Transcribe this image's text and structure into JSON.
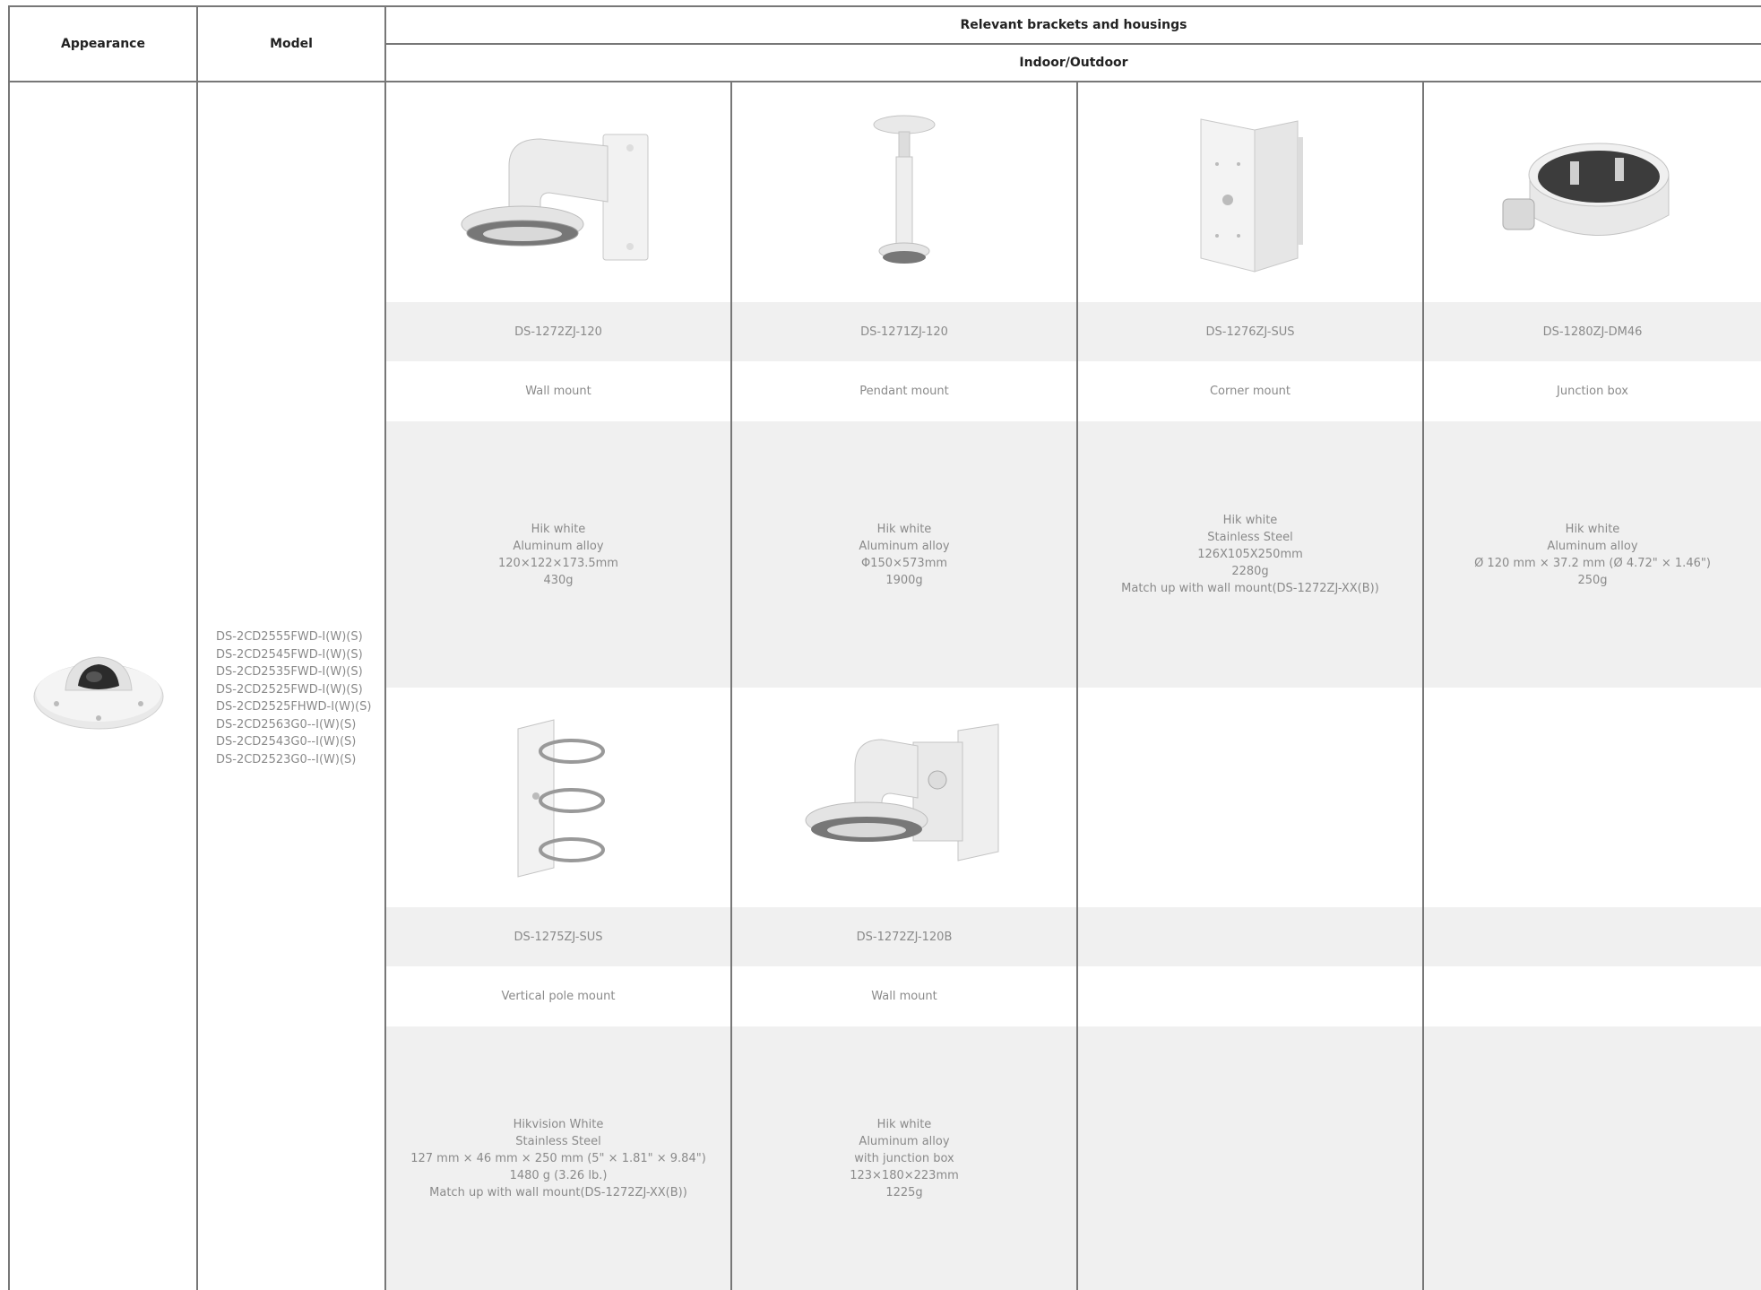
{
  "header": {
    "appearance": "Appearance",
    "model": "Model",
    "relevant": "Relevant brackets and housings",
    "indoor_outdoor": "Indoor/Outdoor"
  },
  "camera": {
    "image_icon": "mini-dome-camera-icon",
    "models": [
      "DS-2CD2555FWD-I(W)(S)",
      "DS-2CD2545FWD-I(W)(S)",
      "DS-2CD2535FWD-I(W)(S)",
      "DS-2CD2525FWD-I(W)(S)",
      "DS-2CD2525FHWD-I(W)(S)",
      "DS-2CD2563G0--I(W)(S)",
      "DS-2CD2543G0--I(W)(S)",
      "DS-2CD2523G0--I(W)(S)"
    ]
  },
  "brackets_row1": [
    {
      "icon": "wall-mount-icon",
      "model": "DS-1272ZJ-120",
      "type": "Wall mount",
      "specs": "Hik white\nAluminum alloy\n120×122×173.5mm\n430g"
    },
    {
      "icon": "pendant-mount-icon",
      "model": "DS-1271ZJ-120",
      "type": "Pendant mount",
      "specs": "Hik white\nAluminum alloy\nΦ150×573mm\n1900g"
    },
    {
      "icon": "corner-mount-icon",
      "model": "DS-1276ZJ-SUS",
      "type": "Corner mount",
      "specs": "Hik white\nStainless Steel\n126X105X250mm\n2280g\nMatch up with wall mount(DS-1272ZJ-XX(B))"
    },
    {
      "icon": "junction-box-icon",
      "model": "DS-1280ZJ-DM46",
      "type": "Junction box",
      "specs": "Hik white\nAluminum alloy\nØ 120 mm × 37.2 mm (Ø 4.72\" × 1.46\")\n250g"
    }
  ],
  "brackets_row2": [
    {
      "icon": "vertical-pole-mount-icon",
      "model": "DS-1275ZJ-SUS",
      "type": "Vertical pole mount",
      "specs": "Hikvision White\nStainless Steel\n127 mm × 46 mm × 250 mm (5\" × 1.81\" × 9.84\")\n1480 g (3.26 lb.)\nMatch up with wall mount(DS-1272ZJ-XX(B))"
    },
    {
      "icon": "wall-mount-junction-box-icon",
      "model": "DS-1272ZJ-120B",
      "type": "Wall mount",
      "specs": "Hik white\nAluminum alloy\nwith junction box\n123×180×223mm\n1225g"
    }
  ]
}
